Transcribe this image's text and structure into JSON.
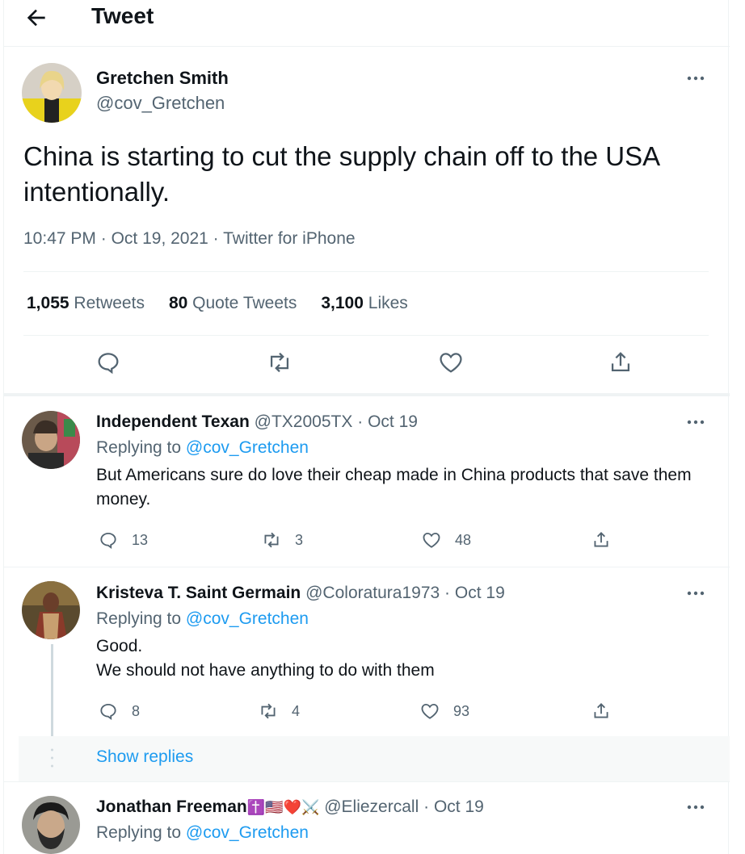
{
  "header": {
    "title": "Tweet",
    "back_icon": "arrow-left-icon"
  },
  "tweet": {
    "name": "Gretchen Smith",
    "handle": "@cov_Gretchen",
    "text": "China is starting to cut the supply chain off to the USA intentionally.",
    "time": "10:47 PM",
    "date": "Oct 19, 2021",
    "source": "Twitter for iPhone",
    "retweets_count": "1,055",
    "retweets_label": "Retweets",
    "quotes_count": "80",
    "quotes_label": "Quote Tweets",
    "likes_count": "3,100",
    "likes_label": "Likes"
  },
  "replies": [
    {
      "name": "Independent Texan",
      "handle": "@TX2005TX",
      "date": "Oct 19",
      "replying_prefix": "Replying to",
      "replying_to": "@cov_Gretchen",
      "text": "But Americans sure do love their cheap made in China products that save them money.",
      "replies": "13",
      "retweets": "3",
      "likes": "48"
    },
    {
      "name": "Kristeva T. Saint Germain",
      "handle": "@Coloratura1973",
      "date": "Oct 19",
      "replying_prefix": "Replying to",
      "replying_to": "@cov_Gretchen",
      "text_line1": "Good.",
      "text_line2": "We should not have anything to do with them",
      "replies": "8",
      "retweets": "4",
      "likes": "93"
    },
    {
      "name": "Jonathan Freeman",
      "name_emoji": "✝️🇺🇸❤️⚔️",
      "handle": "@Eliezercall",
      "date": "Oct 19",
      "replying_prefix": "Replying to",
      "replying_to": "@cov_Gretchen"
    }
  ],
  "show_replies": "Show replies",
  "separator": "·",
  "colors": {
    "link": "#1d9bf0",
    "secondary": "#536471",
    "text": "#0f1419"
  }
}
